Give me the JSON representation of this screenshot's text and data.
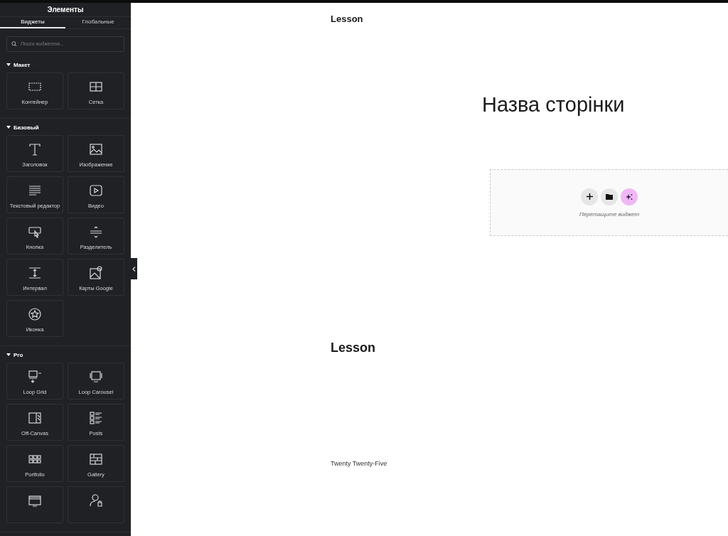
{
  "panel": {
    "title": "Элементы",
    "tabs": [
      {
        "label": "Виджеты",
        "selected": true
      },
      {
        "label": "Глобальные",
        "selected": false
      }
    ],
    "search": {
      "placeholder": "Поиск виджетов..."
    },
    "sections": [
      {
        "title": "Макет",
        "expanded": true,
        "widgets": [
          {
            "kind": "container",
            "label": "Контейнер"
          },
          {
            "kind": "grid",
            "label": "Сетка"
          }
        ]
      },
      {
        "title": "Базовый",
        "expanded": true,
        "widgets": [
          {
            "kind": "heading",
            "label": "Заголовок"
          },
          {
            "kind": "image",
            "label": "Изображение"
          },
          {
            "kind": "text",
            "label": "Текстовый редактор"
          },
          {
            "kind": "video",
            "label": "Видео"
          },
          {
            "kind": "button",
            "label": "Кнопка"
          },
          {
            "kind": "divider",
            "label": "Разделитель"
          },
          {
            "kind": "spacer",
            "label": "Интервал"
          },
          {
            "kind": "map",
            "label": "Карты Google"
          },
          {
            "kind": "icon",
            "label": "Иконка"
          }
        ]
      },
      {
        "title": "Pro",
        "expanded": true,
        "widgets": [
          {
            "kind": "loop-grid",
            "label": "Loop Grid"
          },
          {
            "kind": "loop-carousel",
            "label": "Loop Carousel"
          },
          {
            "kind": "off-canvas",
            "label": "Off-Canvas"
          },
          {
            "kind": "posts",
            "label": "Posts"
          },
          {
            "kind": "portfolio",
            "label": "Portfolio"
          },
          {
            "kind": "gallery",
            "label": "Gallery"
          },
          {
            "kind": "slides"
          },
          {
            "kind": "login"
          }
        ]
      }
    ]
  },
  "canvas": {
    "site_title": "Lesson",
    "page_title": "Назва сторінки",
    "drop_zone": {
      "hint": "Перетащите виджет"
    },
    "footer_title": "Lesson",
    "footer_note": "Twenty Twenty-Five"
  }
}
